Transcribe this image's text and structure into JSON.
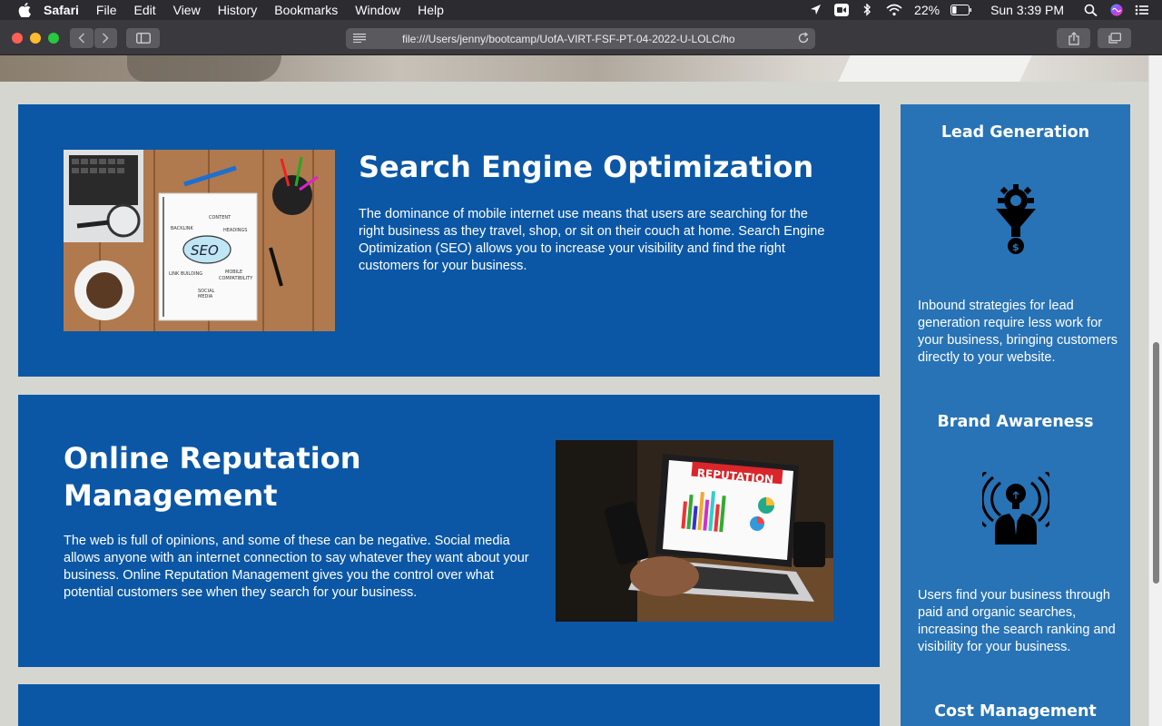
{
  "menubar": {
    "app_name": "Safari",
    "items": [
      "File",
      "Edit",
      "View",
      "History",
      "Bookmarks",
      "Window",
      "Help"
    ],
    "battery": "22%",
    "clock": "Sun 3:39 PM"
  },
  "browser": {
    "url": "file:///Users/jenny/bootcamp/UofA-VIRT-FSF-PT-04-2022-U-LOLC/ho"
  },
  "content": {
    "seo": {
      "title": "Search Engine Optimization",
      "text": "The dominance of mobile internet use means that users are searching for the right business as they travel, shop, or sit on their couch at home. Search Engine Optimization (SEO) allows you to increase your visibility and find the right customers for your business.",
      "image_words": [
        "CONTENT",
        "BACKLINK",
        "HEADINGS",
        "SEO",
        "LINK BUILDING",
        "MOBILE COMPATIBILITY",
        "SOCIAL MEDIA"
      ]
    },
    "reputation": {
      "title": "Online Reputation Management",
      "text": "The web is full of opinions, and some of these can be negative. Social media allows anyone with an internet connection to say whatever they want about your business. Online Reputation Management gives you the control over what potential customers see when they search for your business.",
      "image_banner": "REPUTATION"
    }
  },
  "benefits": [
    {
      "title": "Lead Generation",
      "icon": "lead-generation-funnel-icon",
      "text": "Inbound strategies for lead generation require less work for your business, bringing customers directly to your website."
    },
    {
      "title": "Brand Awareness",
      "icon": "brand-awareness-icon",
      "text": "Users find your business through paid and organic searches, increasing the search ranking and visibility for your business."
    },
    {
      "title": "Cost Management",
      "icon": "cost-management-icon",
      "text": ""
    }
  ],
  "colors": {
    "card_blue": "#0b57a6",
    "aside_blue": "#2873b6",
    "page_bg": "#d5d6d0"
  }
}
